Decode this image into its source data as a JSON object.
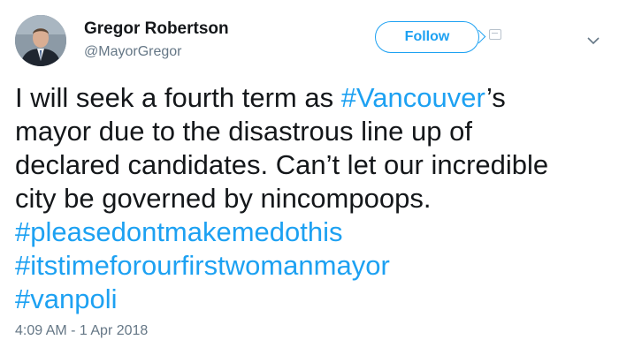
{
  "user": {
    "name": "Gregor Robertson",
    "handle": "@MayorGregor"
  },
  "actions": {
    "follow_label": "Follow"
  },
  "tweet": {
    "line1": {
      "before": "I will seek a fourth term as ",
      "hashtag": "#Vancouver",
      "after": "’s"
    },
    "line2": "mayor due to the disastrous line up of",
    "line3": "declared candidates. Can’t let our incredible",
    "line4": "city be governed by nincompoops.",
    "hashtags": [
      "#pleasedontmakemedothis",
      "#itstimeforourfirstwomanmayor",
      "#vanpoli"
    ]
  },
  "timestamp": "4:09 AM - 1 Apr 2018",
  "colors": {
    "link": "#1da1f2",
    "text": "#14171a",
    "secondary": "#657786"
  },
  "icons": {
    "dropdown": "chevron-down-icon",
    "card": "card-icon"
  }
}
